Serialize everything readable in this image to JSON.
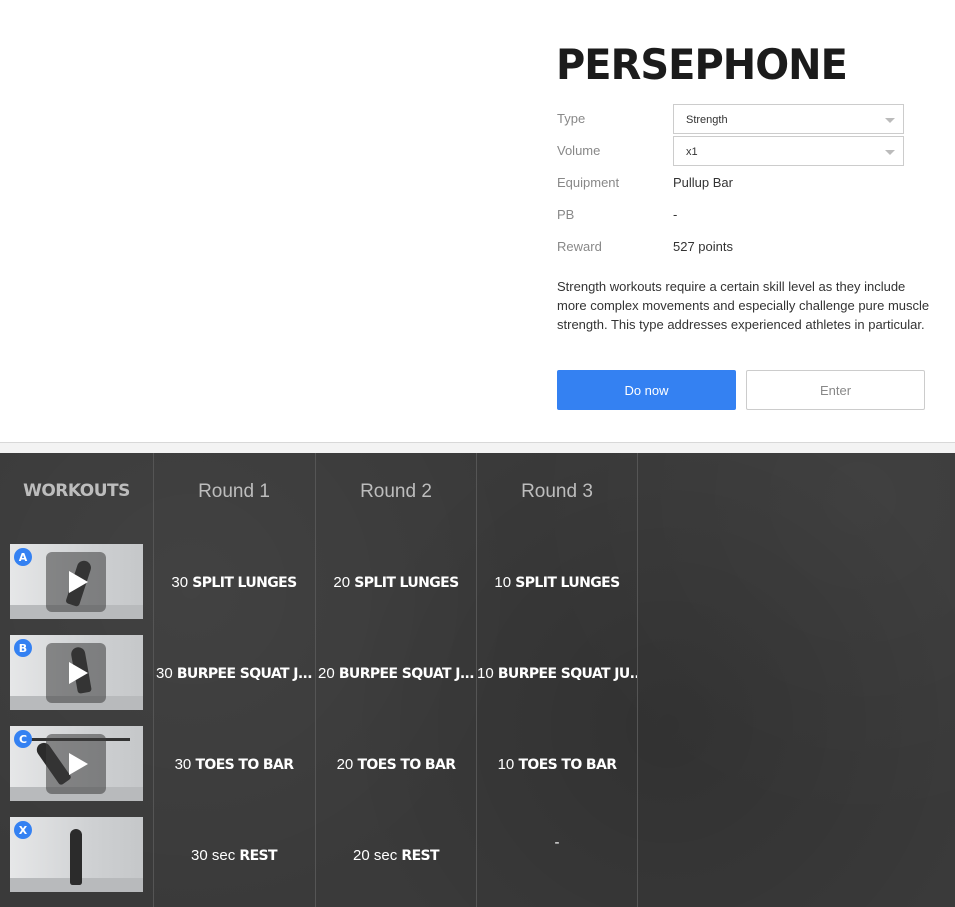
{
  "workout": {
    "title": "PERSEPHONE",
    "props": {
      "type_label": "Type",
      "type_value": "Strength",
      "volume_label": "Volume",
      "volume_value": "x1",
      "equipment_label": "Equipment",
      "equipment_value": "Pullup Bar",
      "pb_label": "PB",
      "pb_value": "-",
      "reward_label": "Reward",
      "reward_value": "527 points"
    },
    "description": "Strength workouts require a certain skill level as they include more complex movements and especially challenge pure muscle strength. This type addresses experienced athletes in particular.",
    "buttons": {
      "do_now": "Do now",
      "enter": "Enter"
    }
  },
  "table": {
    "workouts_header": "WORKOUTS",
    "rounds": [
      "Round 1",
      "Round 2",
      "Round 3"
    ],
    "exercises": [
      {
        "badge": "A",
        "cells": [
          {
            "num": "30",
            "move": "SPLIT LUNGES"
          },
          {
            "num": "20",
            "move": "SPLIT LUNGES"
          },
          {
            "num": "10",
            "move": "SPLIT LUNGES"
          }
        ]
      },
      {
        "badge": "B",
        "cells": [
          {
            "num": "30",
            "move": "BURPEE SQUAT J..."
          },
          {
            "num": "20",
            "move": "BURPEE SQUAT J..."
          },
          {
            "num": "10",
            "move": "BURPEE SQUAT JU..."
          }
        ]
      },
      {
        "badge": "C",
        "cells": [
          {
            "num": "30",
            "move": "TOES TO BAR"
          },
          {
            "num": "20",
            "move": "TOES TO BAR"
          },
          {
            "num": "10",
            "move": "TOES TO BAR"
          }
        ]
      },
      {
        "badge": "X",
        "cells": [
          {
            "num": "30 sec",
            "move": "REST"
          },
          {
            "num": "20 sec",
            "move": "REST"
          },
          {
            "num": "-",
            "move": ""
          }
        ]
      }
    ]
  },
  "colors": {
    "accent": "#3481f2",
    "dark_bg": "#3a3a3a"
  }
}
